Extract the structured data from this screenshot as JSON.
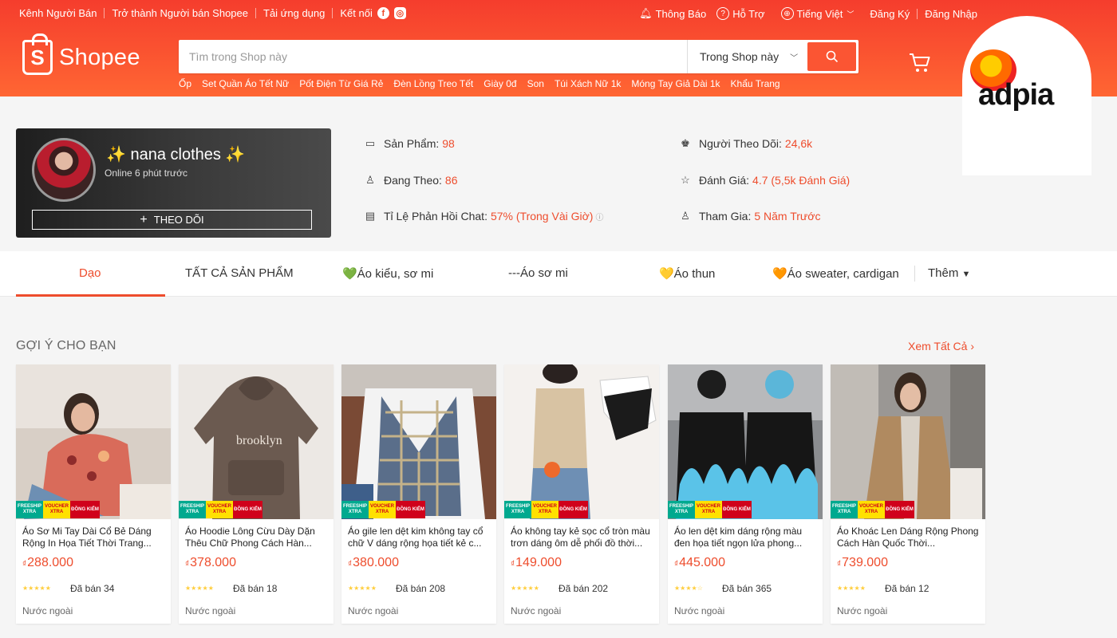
{
  "topbar": {
    "left": [
      "Kênh Người Bán",
      "Trở thành Người bán Shopee",
      "Tải ứng dụng",
      "Kết nối"
    ],
    "notifications": "Thông Báo",
    "help": "Hỗ Trợ",
    "language": "Tiếng Việt",
    "register": "Đăng Ký",
    "login": "Đăng Nhập"
  },
  "brand": {
    "name": "Shopee",
    "partner": "adpia"
  },
  "search": {
    "placeholder": "Tìm trong Shop này",
    "scope": "Trong Shop này"
  },
  "suggestions": [
    "Ốp",
    "Set Quần Áo Tết Nữ",
    "Pốt Điện Từ Giá Rẻ",
    "Đèn Lồng Treo Tết",
    "Giày 0đ",
    "Son",
    "Túi Xách Nữ 1k",
    "Móng Tay Giả Dài 1k",
    "Khẩu Trang"
  ],
  "shop": {
    "name": "✨ nana clothes ✨",
    "online": "Online 6 phút trước",
    "follow": "THEO DÕI"
  },
  "stats": {
    "products": {
      "label": "Sản Phẩm:",
      "value": "98"
    },
    "followers": {
      "label": "Người Theo Dõi:",
      "value": "24,6k"
    },
    "following": {
      "label": "Đang Theo:",
      "value": "86"
    },
    "rating": {
      "label": "Đánh Giá:",
      "value": "4.7 (5,5k Đánh Giá)"
    },
    "chat": {
      "label": "Tỉ Lệ Phản Hồi Chat:",
      "value": "57% (Trong Vài Giờ)"
    },
    "joined": {
      "label": "Tham Gia:",
      "value": "5 Năm Trước"
    }
  },
  "tabs": [
    "Dạo",
    "TẤT CẢ SẢN PHẨM",
    "💚Áo kiểu, sơ mi",
    "---Áo sơ mi",
    "💛Áo thun",
    "🧡Áo sweater, cardigan",
    "Thêm"
  ],
  "section": {
    "title": "GỢI Ý CHO BẠN",
    "view_all": "Xem Tất Cả"
  },
  "badges": {
    "freeship": "FREESHIP XTRA",
    "voucher": "VOUCHER XTRA",
    "dongkiem": "ĐỒNG KIỂM"
  },
  "products": [
    {
      "title": "Áo Sơ Mi Tay Dài Cổ Bẻ Dáng Rộng In Họa Tiết Thời Trang...",
      "currency": "₫",
      "price": "288.000",
      "sold": "Đã bán 34",
      "location": "Nước ngoài",
      "rating": 5
    },
    {
      "title": "Áo Hoodie Lông Cừu Dày Dặn Thêu Chữ Phong Cách Hàn...",
      "currency": "₫",
      "price": "378.000",
      "sold": "Đã bán 18",
      "location": "Nước ngoài",
      "rating": 5
    },
    {
      "title": "Áo gile len dệt kim không tay cổ chữ V dáng rộng họa tiết kẻ c...",
      "currency": "₫",
      "price": "380.000",
      "sold": "Đã bán 208",
      "location": "Nước ngoài",
      "rating": 5
    },
    {
      "title": "Áo không tay kẻ sọc cổ tròn màu trơn dáng ôm dễ phối đồ thời...",
      "currency": "₫",
      "price": "149.000",
      "sold": "Đã bán 202",
      "location": "Nước ngoài",
      "rating": 5
    },
    {
      "title": "Áo len dệt kim dáng rộng màu đen họa tiết ngọn lửa phong...",
      "currency": "₫",
      "price": "445.000",
      "sold": "Đã bán 365",
      "location": "Nước ngoài",
      "rating": 4.5
    },
    {
      "title": "Áo Khoác Len Dáng Rộng Phong Cách Hàn Quốc Thời...",
      "currency": "₫",
      "price": "739.000",
      "sold": "Đã bán 12",
      "location": "Nước ngoài",
      "rating": 5
    }
  ],
  "colors": {
    "brand": "#ee4d2d",
    "header_top": "#f53d2d",
    "header_bottom": "#ff6633",
    "star": "#ffce3d"
  }
}
